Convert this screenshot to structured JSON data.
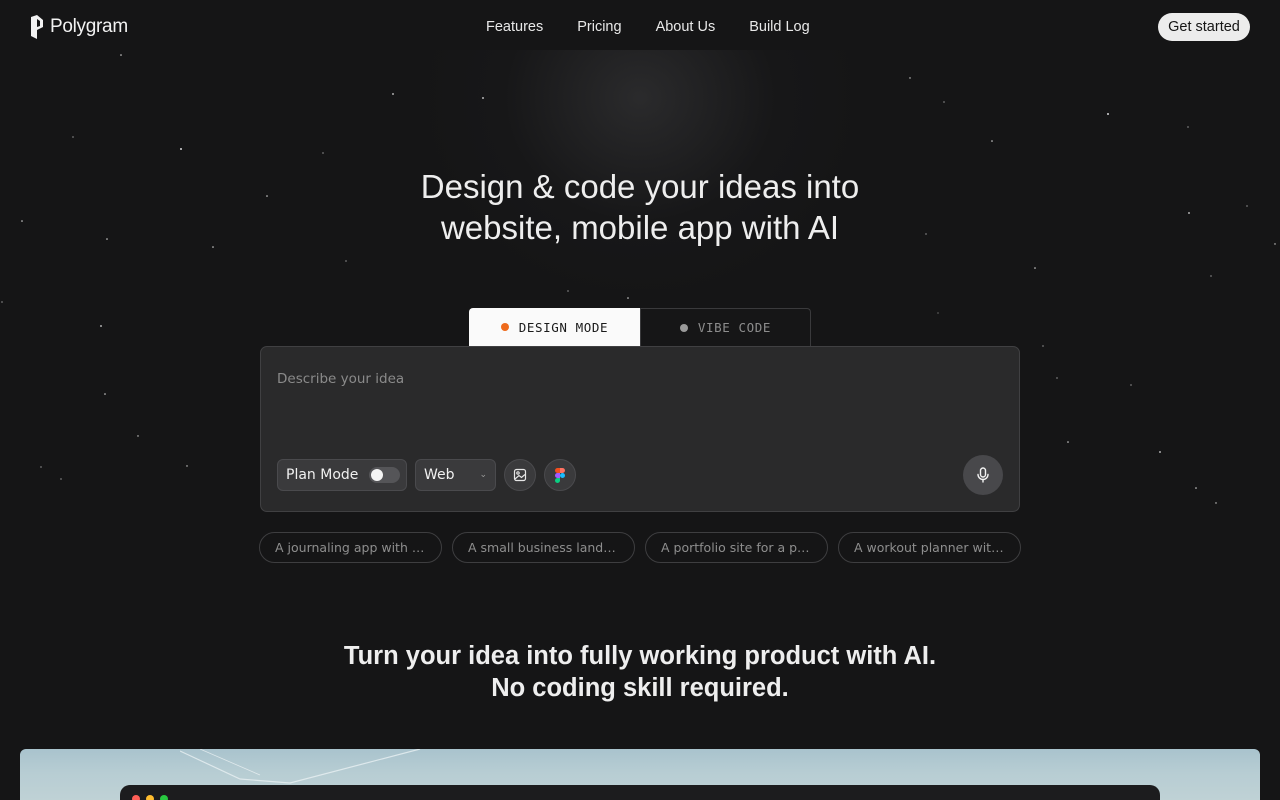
{
  "brand": {
    "name": "Polygram"
  },
  "nav": {
    "links": [
      "Features",
      "Pricing",
      "About Us",
      "Build Log"
    ],
    "cta": "Get started"
  },
  "hero": {
    "title_line1": "Design & code your ideas into",
    "title_line2": "website, mobile app with AI"
  },
  "modes": {
    "design": "DESIGN MODE",
    "vibe": "VIBE CODE",
    "active": "design",
    "active_dot_color": "#ee6a1c"
  },
  "prompt": {
    "placeholder": "Describe your idea",
    "value": "",
    "plan_mode_label": "Plan Mode",
    "plan_mode_on": false,
    "platform": "Web",
    "icons": [
      "image-upload-icon",
      "figma-icon",
      "microphone-icon"
    ]
  },
  "suggestions": [
    "A journaling app with mood tracking",
    "A small business landing page",
    "A portfolio site for a photographer",
    "A workout planner with progress charts"
  ],
  "subheadline": {
    "line1": "Turn your idea into fully working product with AI.",
    "line2": "No coding skill required."
  },
  "preview": {
    "window_dots": [
      "#ff5f57",
      "#febc2e",
      "#28c840"
    ]
  }
}
